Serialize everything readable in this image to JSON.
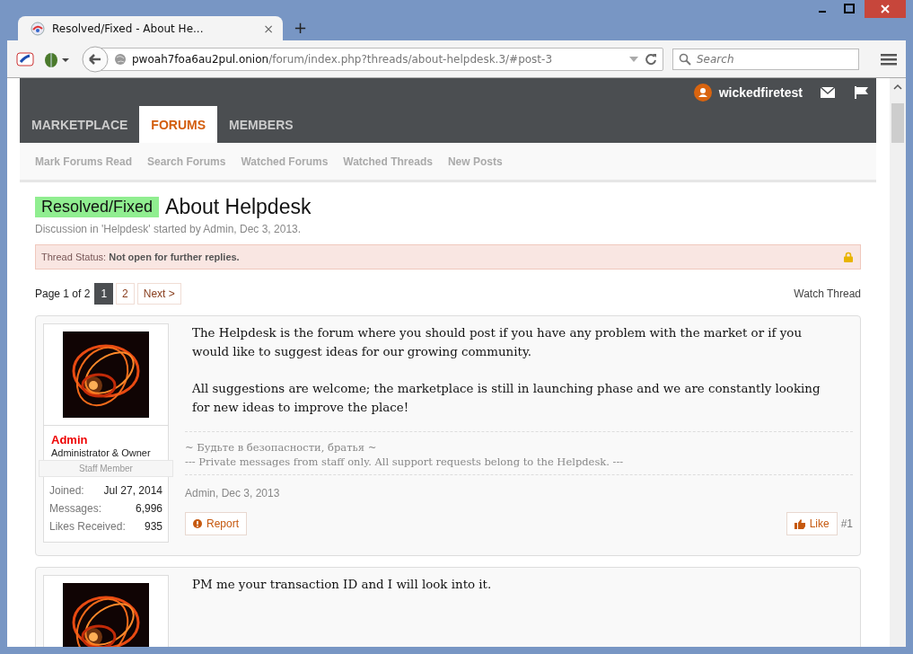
{
  "browser": {
    "tab_title": "Resolved/Fixed - About He...",
    "tab_close": "×",
    "new_tab": "+",
    "url_host": "pwoah7foa6au2pul.onion",
    "url_path": "/forum/index.php?threads/about-helpdesk.3/#post-3",
    "search_placeholder": "Search"
  },
  "header": {
    "username": "wickedfiretest",
    "tabs": [
      {
        "label": "MARKETPLACE",
        "selected": false
      },
      {
        "label": "FORUMS",
        "selected": true
      },
      {
        "label": "MEMBERS",
        "selected": false
      }
    ],
    "subnav": [
      "Mark Forums Read",
      "Search Forums",
      "Watched Forums",
      "Watched Threads",
      "New Posts"
    ]
  },
  "thread": {
    "prefix": "Resolved/Fixed",
    "title": "About Helpdesk",
    "description": "Discussion in 'Helpdesk' started by Admin, Dec 3, 2013.",
    "status_label": "Thread Status:",
    "status_text": "Not open for further replies.",
    "page_label": "Page 1 of 2",
    "pages": [
      {
        "label": "1",
        "selected": true
      },
      {
        "label": "2",
        "selected": false
      }
    ],
    "next": "Next >",
    "watch": "Watch Thread"
  },
  "posts": [
    {
      "kind": "full",
      "username": "Admin",
      "title": "Administrator & Owner",
      "banner": "Staff Member",
      "stats": [
        {
          "label": "Joined:",
          "value": "Jul 27, 2014"
        },
        {
          "label": "Messages:",
          "value": "6,996"
        },
        {
          "label": "Likes Received:",
          "value": "935"
        }
      ],
      "paragraphs": [
        "The Helpdesk is the forum where you should post if you have any problem with the market or if you would like to suggest ideas for our growing community.",
        "All suggestions are welcome; the marketplace is still in launching phase and we are constantly looking for new ideas to improve the place!"
      ],
      "signature": [
        "~ Будьте в безопасности, братья ~",
        "--- Private messages from staff only. All support requests belong to the Helpdesk. ---"
      ],
      "meta": "Admin, Dec 3, 2013",
      "report": "Report",
      "like": "Like",
      "number": "#1"
    },
    {
      "kind": "partial",
      "paragraphs": [
        "PM me your transaction ID and I will look into it."
      ]
    }
  ]
}
